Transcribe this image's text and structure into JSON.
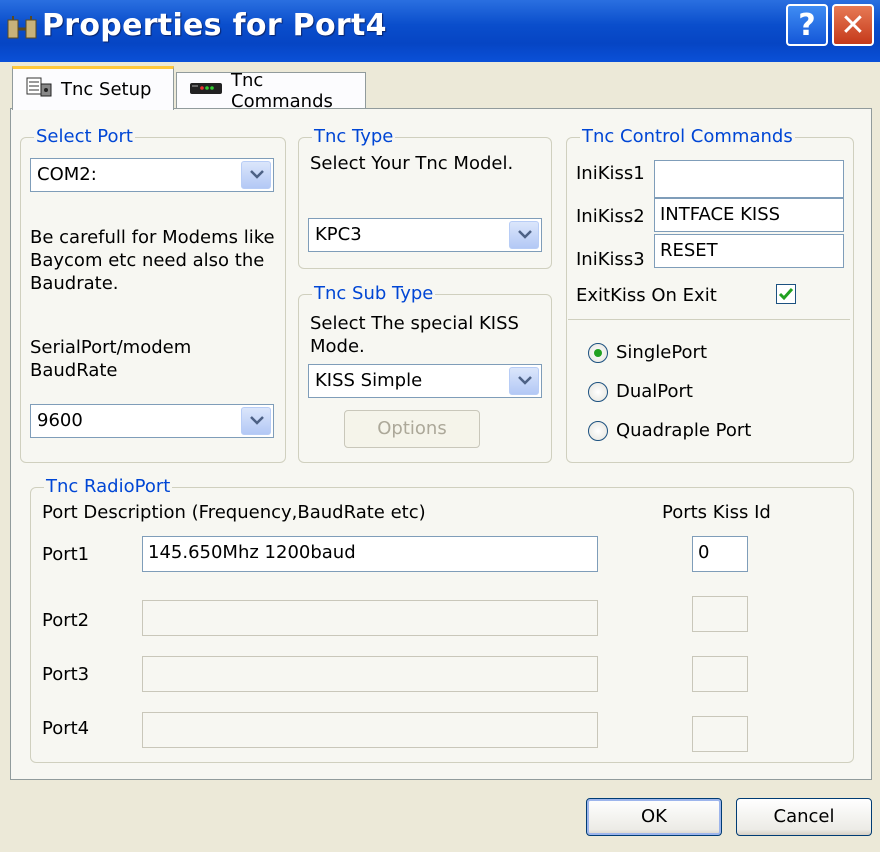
{
  "window": {
    "title": "Properties for Port4",
    "help_glyph": "?",
    "close_glyph": "✕",
    "title_bar_color": "#0a4ecc"
  },
  "tabs": [
    {
      "label": "Tnc Setup",
      "icon": "tnc-setup-icon",
      "active": true
    },
    {
      "label": "Tnc Commands",
      "icon": "modem-icon",
      "active": false
    }
  ],
  "select_port": {
    "legend": "Select Port",
    "port_value": "COM2:",
    "note": [
      "Be carefull for Modems like",
      "Baycom etc need also the",
      "Baudrate."
    ],
    "baud_label": [
      "SerialPort/modem",
      "BaudRate"
    ],
    "baud_value": "9600"
  },
  "tnc_type": {
    "legend": "Tnc Type",
    "hint": "Select Your Tnc Model.",
    "model_value": "KPC3"
  },
  "tnc_sub_type": {
    "legend": "Tnc Sub Type",
    "hint": [
      "Select The special KISS",
      "Mode."
    ],
    "mode_value": "KISS Simple",
    "options_label": "Options"
  },
  "control_commands": {
    "legend": "Tnc Control Commands",
    "inikiss1_label": "IniKiss1",
    "inikiss1_value": "",
    "inikiss2_label": "IniKiss2",
    "inikiss2_value": "INTFACE KISS",
    "inikiss3_label": "IniKiss3",
    "inikiss3_value": "RESET",
    "exitkiss_label": "ExitKiss On Exit",
    "exitkiss_checked": true,
    "port_modes": [
      {
        "label": "SinglePort",
        "selected": true
      },
      {
        "label": "DualPort",
        "selected": false
      },
      {
        "label": "Quadraple Port",
        "selected": false
      }
    ]
  },
  "radio_port": {
    "legend": "Tnc RadioPort",
    "desc_header": "Port Description (Frequency,BaudRate etc)",
    "kiss_header": "Ports Kiss Id",
    "ports": [
      {
        "label": "Port1",
        "description": "145.650Mhz 1200baud",
        "kiss_id": "0",
        "enabled": true
      },
      {
        "label": "Port2",
        "description": "",
        "kiss_id": "",
        "enabled": false
      },
      {
        "label": "Port3",
        "description": "",
        "kiss_id": "",
        "enabled": false
      },
      {
        "label": "Port4",
        "description": "",
        "kiss_id": "",
        "enabled": false
      }
    ]
  },
  "footer": {
    "ok_label": "OK",
    "cancel_label": "Cancel"
  }
}
